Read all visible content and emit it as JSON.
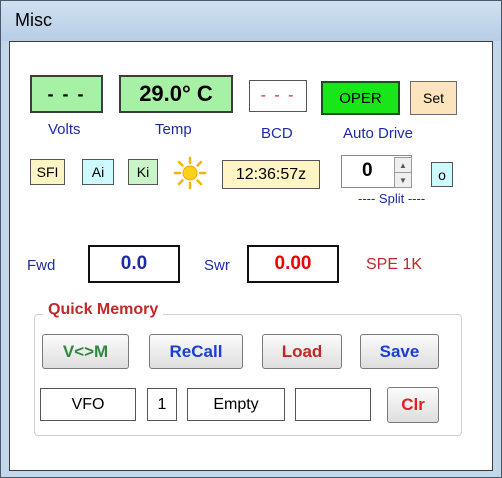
{
  "window": {
    "title": "Misc"
  },
  "status": {
    "volts_value": "- - -",
    "volts_label": "Volts",
    "temp_value": "29.0° C",
    "temp_label": "Temp",
    "bcd_value": "- - -",
    "bcd_label": "BCD",
    "oper_button": "OPER",
    "set_button": "Set",
    "auto_drive_label": "Auto Drive"
  },
  "indicators": {
    "sfi": "SFI",
    "ai": "Ai",
    "ki": "Ki",
    "sun_icon": "sun-icon",
    "time": "12:36:57z",
    "split_value": "0",
    "split_toggle": "o",
    "split_label": "---- Split ----"
  },
  "power": {
    "fwd_label": "Fwd",
    "fwd_value": "0.0",
    "swr_label": "Swr",
    "swr_value": "0.00",
    "model": "SPE 1K"
  },
  "quick_memory": {
    "title": "Quick Memory",
    "buttons": {
      "vm": "V<>M",
      "recall": "ReCall",
      "load": "Load",
      "save": "Save",
      "clear": "Clr"
    },
    "fields": {
      "vfo": "VFO",
      "slot": "1",
      "state": "Empty",
      "extra": ""
    }
  },
  "colors": {
    "green_box": "#a6f1a6",
    "oper_green": "#19e619",
    "set_orange": "#fce4bd",
    "yellow_box": "#fff5c4",
    "cyan_box": "#cdfaff",
    "light_green": "#c9f5c9",
    "blue_text": "#1e2aa5",
    "red_text": "#c0282a"
  }
}
